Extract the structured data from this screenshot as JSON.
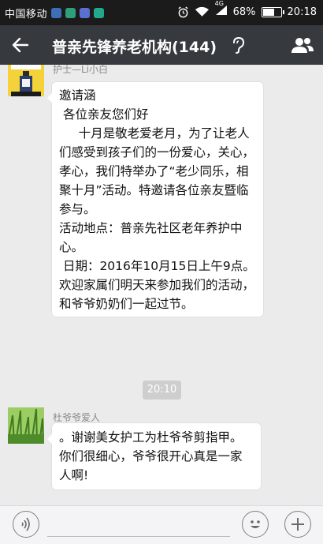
{
  "status_bar": {
    "carrier": "中国移动",
    "network": "4G",
    "battery_percent": "68%",
    "battery_level": 0.68,
    "time": "20:18"
  },
  "header": {
    "title": "普亲先锋养老机构(144)",
    "back_icon": "arrow-left-icon",
    "earpiece_icon": "earpiece-mode-icon",
    "members_icon": "group-members-icon"
  },
  "messages": [
    {
      "sender": "护士—Li小白",
      "text": "邀请涵\n 各位亲友您们好\n     十月是敬老爱老月，为了让老人们感受到孩子们的一份爱心，关心，孝心，我们特举办了“老少同乐，相聚十月”活动。特邀请各位亲友暨临参与。\n活动地点：普亲先社区老年养护中心。\n 日期：2016年10月15日上午9点。欢迎家属们明天来参加我们的活动，和爷爷奶奶们一起过节。"
    },
    {
      "sender": "杜爷爷爱人",
      "text": "。谢谢美女护工为杜爷爷剪指甲。你们很细心，爷爷很开心真是一家人啊!"
    }
  ],
  "time_divider": "20:10",
  "input_bar": {
    "voice_icon": "voice-input-icon",
    "emoji_icon": "emoji-icon",
    "plus_icon": "plus-icon"
  },
  "colors": {
    "header_bg": "#363a3f",
    "status_bg": "#1b1b1b",
    "chat_bg": "#ebebeb",
    "bubble_bg": "#ffffff"
  }
}
